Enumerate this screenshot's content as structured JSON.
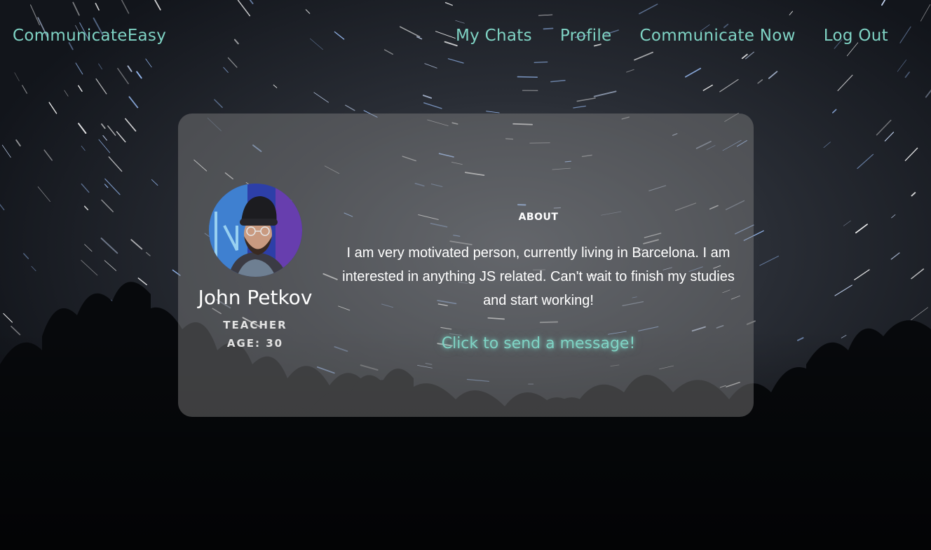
{
  "nav": {
    "brand": "CommunicateEasy",
    "links": [
      {
        "label": "My Chats"
      },
      {
        "label": "Profile"
      },
      {
        "label": "Communicate Now"
      },
      {
        "label": "Log Out"
      }
    ]
  },
  "profile": {
    "name": "John Petkov",
    "role": "TEACHER",
    "age_label": "AGE: 30"
  },
  "about": {
    "heading": "ABOUT",
    "text": "I am very motivated person, currently living in Barcelona. I am interested in anything JS related. Can't wait to finish my studies and start working!"
  },
  "cta": {
    "send_message": "Click to send a message!"
  },
  "colors": {
    "accent": "#7fd3c4",
    "card": "rgba(130,130,130,0.45)",
    "text": "#ffffff"
  }
}
